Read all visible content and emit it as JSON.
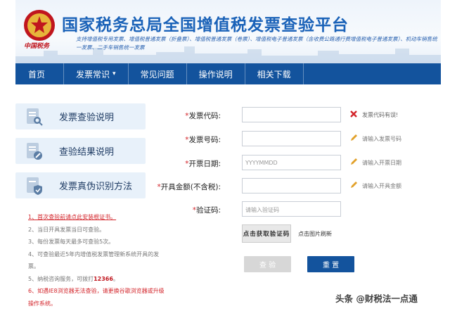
{
  "header": {
    "emblem_caption": "中国税务",
    "title": "国家税务总局全国增值税发票查验平台",
    "support_text": "支持增值税专用发票、增值税普通发票（折叠票）、增值税普通发票（卷票）、增值税电子普通发票（含收费公路通行费增值税电子普通发票）、机动车销售统一发票、二手车销售统一发票"
  },
  "nav": {
    "items": [
      {
        "label": "首页"
      },
      {
        "label": "发票常识",
        "caret": "▾"
      },
      {
        "label": "常见问题"
      },
      {
        "label": "操作说明"
      },
      {
        "label": "相关下载"
      }
    ]
  },
  "side": {
    "cards": [
      {
        "label": "发票查验说明",
        "icon": "document-search-icon"
      },
      {
        "label": "查验结果说明",
        "icon": "document-edit-icon"
      },
      {
        "label": "发票真伪识别方法",
        "icon": "shield-check-icon"
      }
    ],
    "notes": [
      "1、首次查验前请点此安装根证书。",
      "2、当日开具发票当日可查验。",
      "3、每份发票每天最多可查验5次。",
      "4、可查验最近5年内增值税发票管理新系统开具的发票。",
      "5、纳税咨询服务，可拨打",
      "12366",
      "。",
      "6、如遇IE8浏览器无法查验，请更换谷歌浏览器或升级操作系统。"
    ]
  },
  "form": {
    "code": {
      "label": "发票代码:",
      "value": "",
      "hint": "发票代码有误!"
    },
    "number": {
      "label": "发票号码:",
      "value": "",
      "hint": "请输入发票号码"
    },
    "date": {
      "label": "开票日期:",
      "placeholder": "YYYYMMDD",
      "hint": "请输入开票日期"
    },
    "amount": {
      "label": "开具金额(不含税):",
      "value": "",
      "hint": "请输入开具金额"
    },
    "captcha": {
      "label": "验证码:",
      "placeholder": "请输入验证码",
      "image_text": "点击获取验证码",
      "refresh_text": "点击图片刷新"
    },
    "star": "*",
    "query_label": "查 验",
    "reset_label": "重 置"
  },
  "watermark": "头条 @财税法一点通",
  "colors": {
    "nav": "#13539d",
    "title": "#1a62b8",
    "error": "#d3252b",
    "side_card": "#e8f1fa"
  }
}
